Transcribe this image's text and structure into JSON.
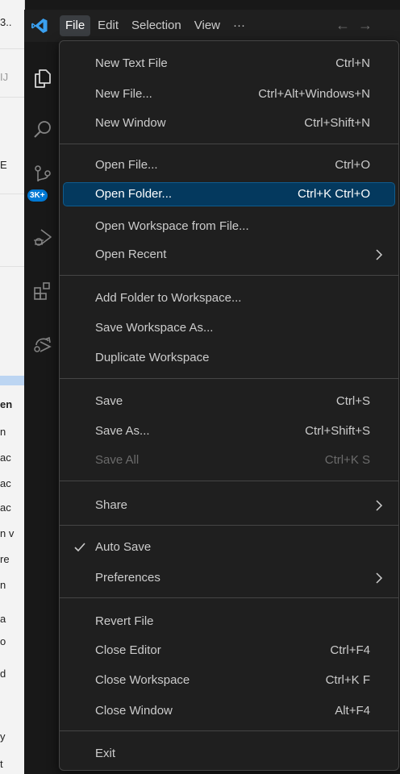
{
  "titlebar": {
    "menus": [
      "File",
      "Edit",
      "Selection",
      "View",
      "···"
    ],
    "active_menu": "File",
    "back_glyph": "←",
    "forward_glyph": "→"
  },
  "background_window": {
    "fragments": [
      "3..",
      "IJ",
      "E",
      "en",
      "n",
      "ac",
      "ac",
      "ac",
      "n v",
      "re",
      "n",
      "a",
      "o",
      "d",
      "y",
      "t"
    ]
  },
  "activity_bar": {
    "icons": [
      "explorer-icon",
      "search-icon",
      "source-control-icon",
      "run-debug-icon",
      "extensions-icon",
      "remote-explorer-icon"
    ],
    "source_control_badge": "3K+"
  },
  "file_menu": {
    "items": [
      {
        "label": "New Text File",
        "shortcut": "Ctrl+N"
      },
      {
        "label": "New File...",
        "shortcut": "Ctrl+Alt+Windows+N"
      },
      {
        "label": "New Window",
        "shortcut": "Ctrl+Shift+N"
      },
      {
        "label": "Open File...",
        "shortcut": "Ctrl+O"
      },
      {
        "label": "Open Folder...",
        "shortcut": "Ctrl+K Ctrl+O",
        "highlighted": true
      },
      {
        "label": "Open Workspace from File...",
        "shortcut": ""
      },
      {
        "label": "Open Recent",
        "shortcut": "",
        "submenu": true
      },
      {
        "label": "Add Folder to Workspace...",
        "shortcut": ""
      },
      {
        "label": "Save Workspace As...",
        "shortcut": ""
      },
      {
        "label": "Duplicate Workspace",
        "shortcut": ""
      },
      {
        "label": "Save",
        "shortcut": "Ctrl+S"
      },
      {
        "label": "Save As...",
        "shortcut": "Ctrl+Shift+S"
      },
      {
        "label": "Save All",
        "shortcut": "Ctrl+K S",
        "disabled": true
      },
      {
        "label": "Share",
        "shortcut": "",
        "submenu": true
      },
      {
        "label": "Auto Save",
        "shortcut": "",
        "checked": true
      },
      {
        "label": "Preferences",
        "shortcut": "",
        "submenu": true
      },
      {
        "label": "Revert File",
        "shortcut": ""
      },
      {
        "label": "Close Editor",
        "shortcut": "Ctrl+F4"
      },
      {
        "label": "Close Workspace",
        "shortcut": "Ctrl+K F"
      },
      {
        "label": "Close Window",
        "shortcut": "Alt+F4"
      },
      {
        "label": "Exit",
        "shortcut": ""
      }
    ]
  },
  "colors": {
    "menu_background": "#1f1f1f",
    "highlight": "#04395e",
    "accent": "#0078d4",
    "logo_blue": "#3aa0f0"
  }
}
